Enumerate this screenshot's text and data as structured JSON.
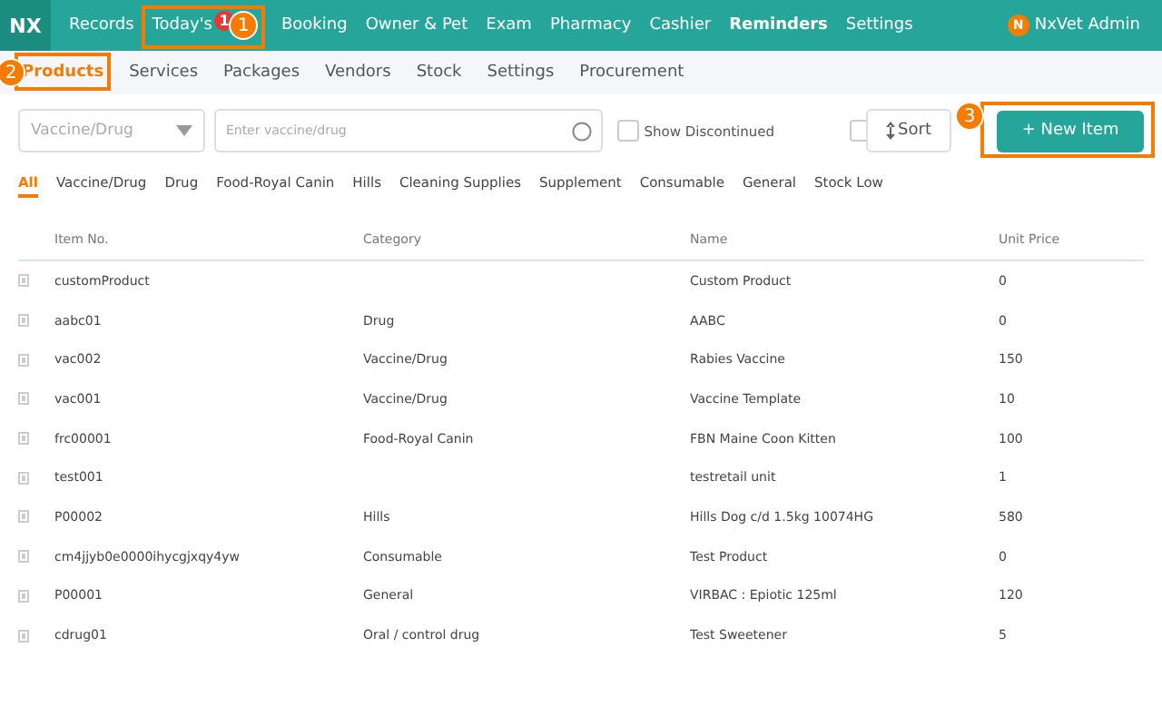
{
  "top_nav": {
    "logo": "NX",
    "items": [
      {
        "label": "Records",
        "selected": false
      },
      {
        "label": "Today's",
        "selected": false,
        "badge": "1"
      },
      {
        "label": "Booking",
        "selected": false
      },
      {
        "label": "Owner & Pet",
        "selected": false
      },
      {
        "label": "Exam",
        "selected": false
      },
      {
        "label": "Pharmacy",
        "selected": false
      },
      {
        "label": "Cashier",
        "selected": false
      },
      {
        "label": "Reminders",
        "selected": true
      },
      {
        "label": "Settings",
        "selected": false
      }
    ],
    "user": {
      "initial": "N",
      "name": "NxVet Admin"
    }
  },
  "sub_tabs": [
    {
      "label": "Products",
      "selected": true
    },
    {
      "label": "Services",
      "selected": false
    },
    {
      "label": "Packages",
      "selected": false
    },
    {
      "label": "Vendors",
      "selected": false
    },
    {
      "label": "Stock",
      "selected": false
    },
    {
      "label": "Settings",
      "selected": false
    },
    {
      "label": "Procurement",
      "selected": false
    }
  ],
  "filters": {
    "type_select": {
      "placeholder": "Vaccine/Drug"
    },
    "search": {
      "placeholder": "Enter vaccine/drug"
    },
    "show_discontinued": {
      "label": "Show Discontinued",
      "checked": false
    },
    "extra_checkbox": {
      "checked": false
    },
    "sort_button": "Sort",
    "new_button": "+ New Item"
  },
  "category_tabs": [
    {
      "label": "All",
      "selected": true
    },
    {
      "label": "Vaccine/Drug",
      "selected": false
    },
    {
      "label": "Drug",
      "selected": false
    },
    {
      "label": "Food-Royal Canin",
      "selected": false
    },
    {
      "label": "Hills",
      "selected": false
    },
    {
      "label": "Cleaning Supplies",
      "selected": false
    },
    {
      "label": "Supplement",
      "selected": false
    },
    {
      "label": "Consumable",
      "selected": false
    },
    {
      "label": "General",
      "selected": false
    },
    {
      "label": "Stock Low",
      "selected": false
    }
  ],
  "table": {
    "columns": [
      "Item No.",
      "Category",
      "Name",
      "Unit Price"
    ],
    "rows": [
      [
        "customProduct",
        "",
        "Custom Product",
        "0"
      ],
      [
        "aabc01",
        "Drug",
        "AABC",
        "0"
      ],
      [
        "vac002",
        "Vaccine/Drug",
        "Rabies Vaccine",
        "150"
      ],
      [
        "vac001",
        "Vaccine/Drug",
        "Vaccine Template",
        "10"
      ],
      [
        "frc00001",
        "Food-Royal Canin",
        "FBN Maine Coon Kitten",
        "100"
      ],
      [
        "test001",
        "",
        "testretail unit",
        "1"
      ],
      [
        "P00002",
        "Hills",
        "Hills Dog c/d 1.5kg 10074HG",
        "580"
      ],
      [
        "cm4jjyb0e0000ihycgjxqy4yw",
        "Consumable",
        "Test Product",
        "0"
      ],
      [
        "P00001",
        "General",
        "VIRBAC : Epiotic 125ml",
        "120"
      ],
      [
        "cdrug01",
        "Oral / control drug",
        "Test Sweetener",
        "5"
      ]
    ]
  },
  "callouts": [
    {
      "label": "1"
    },
    {
      "label": "2"
    },
    {
      "label": "3"
    }
  ]
}
